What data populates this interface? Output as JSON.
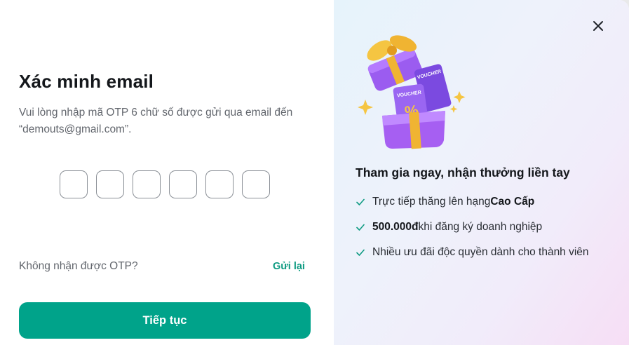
{
  "verify": {
    "title": "Xác minh email",
    "description": "Vui lòng nhập mã OTP 6 chữ số được gửi qua email đến “demouts@gmail.com”.",
    "otp_count": 6,
    "resend_prompt": "Không nhận được OTP?",
    "resend_link": "Gửi lại",
    "continue_label": "Tiếp tục"
  },
  "promo": {
    "title": "Tham gia ngay, nhận thưởng liền tay",
    "voucher_text": "VOUCHER",
    "benefits": [
      {
        "before": "Trực tiếp thăng lên hạng ",
        "bold": "Cao Cấp",
        "after": ""
      },
      {
        "before": "",
        "bold": "500.000đ",
        "after": " khi đăng ký doanh nghiệp"
      },
      {
        "before": "Nhiều ưu đãi độc quyền dành cho thành viên",
        "bold": "",
        "after": ""
      }
    ]
  },
  "icons": {
    "close": "close-icon",
    "check": "check-icon",
    "gift": "gift-voucher-illustration"
  },
  "colors": {
    "accent": "#00a38a",
    "accent_text": "#0f9b82",
    "check": "#0f9b82"
  }
}
